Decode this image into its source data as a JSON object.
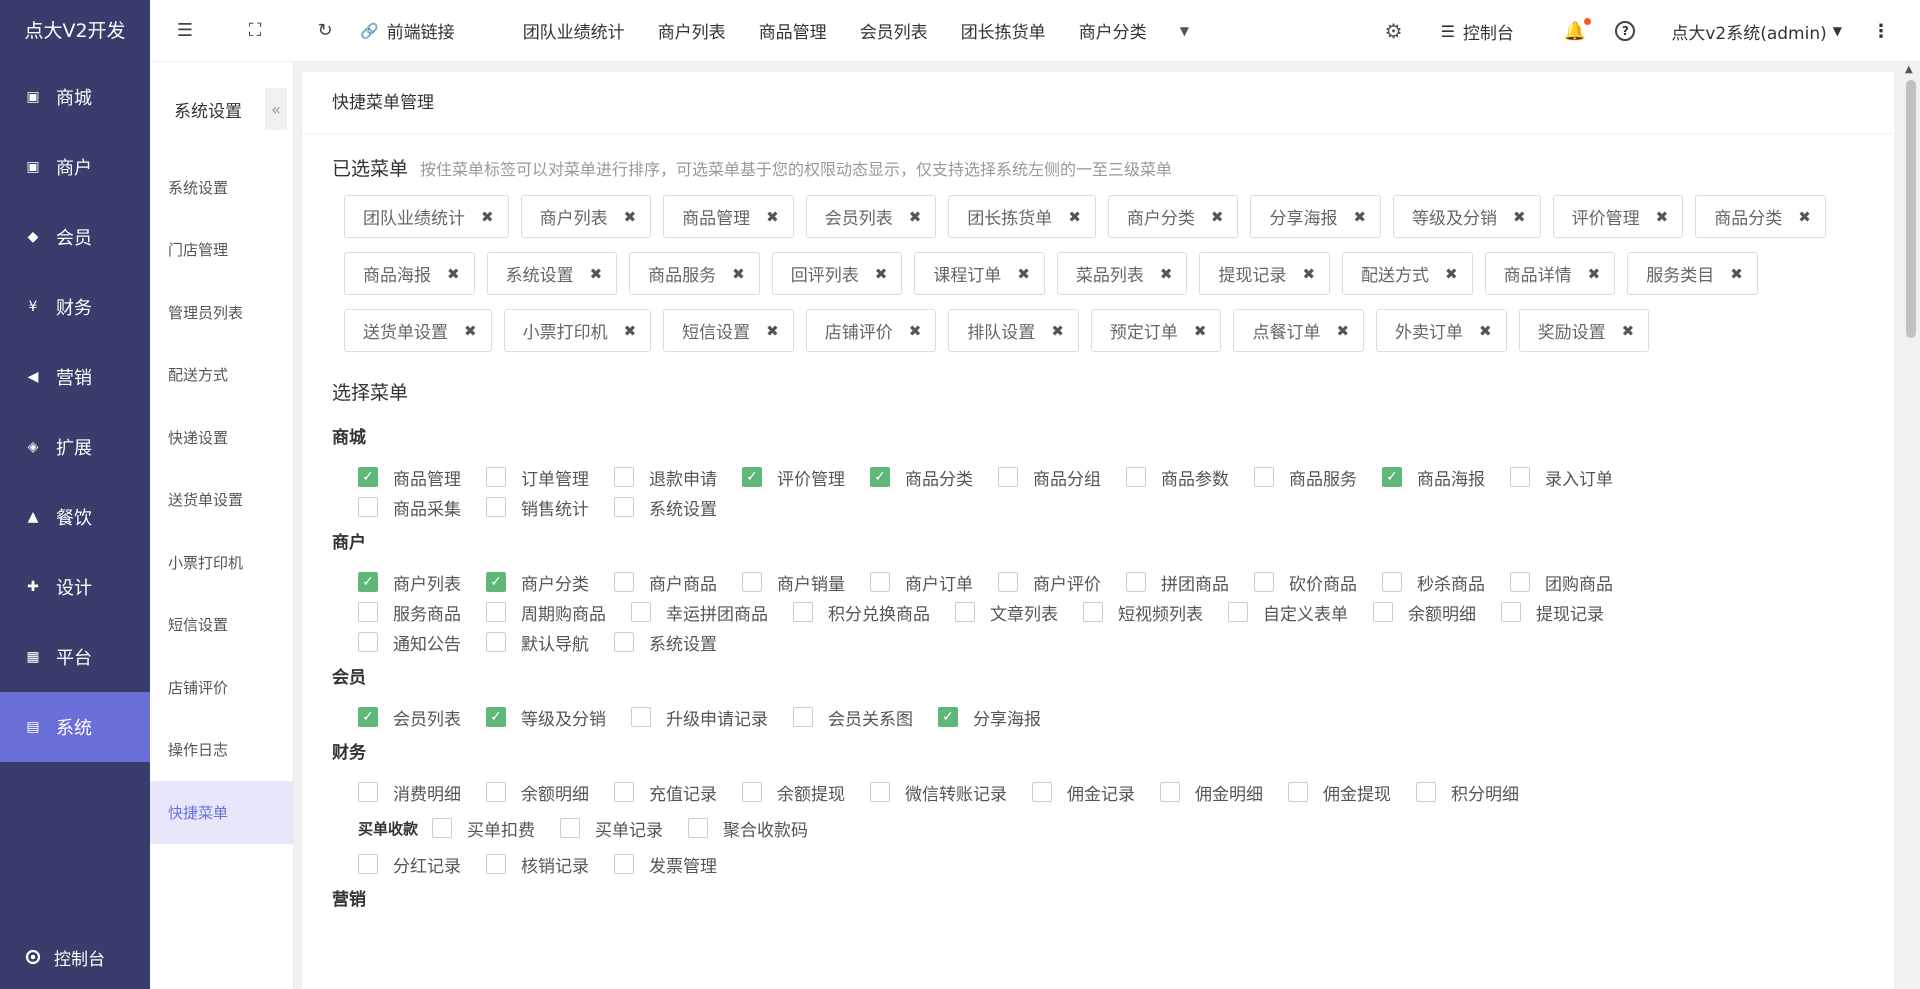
{
  "brand": "点大V2开发",
  "nav": [
    {
      "label": "商城",
      "icon": "shop-icon"
    },
    {
      "label": "商户",
      "icon": "merchant-icon"
    },
    {
      "label": "会员",
      "icon": "member-icon"
    },
    {
      "label": "财务",
      "icon": "finance-icon"
    },
    {
      "label": "营销",
      "icon": "marketing-icon"
    },
    {
      "label": "扩展",
      "icon": "extension-icon"
    },
    {
      "label": "餐饮",
      "icon": "dining-icon"
    },
    {
      "label": "设计",
      "icon": "design-icon"
    },
    {
      "label": "平台",
      "icon": "platform-icon"
    },
    {
      "label": "系统",
      "icon": "system-icon",
      "active": true
    }
  ],
  "nav_bottom": {
    "label": "控制台",
    "icon": "gear-icon"
  },
  "submenu": {
    "title": "系统设置",
    "items": [
      "系统设置",
      "门店管理",
      "管理员列表",
      "配送方式",
      "快递设置",
      "送货单设置",
      "小票打印机",
      "短信设置",
      "店铺评价",
      "操作日志",
      "快捷菜单"
    ],
    "active_index": 10
  },
  "topbar": {
    "frontend_link": "前端链接",
    "links": [
      "团队业绩统计",
      "商户列表",
      "商品管理",
      "会员列表",
      "团长拣货单",
      "商户分类"
    ],
    "console": "控制台",
    "user": "点大v2系统(admin)"
  },
  "card_title": "快捷菜单管理",
  "selected": {
    "title": "已选菜单",
    "hint": "按住菜单标签可以对菜单进行排序，可选菜单基于您的权限动态显示，仅支持选择系统左侧的一至三级菜单",
    "chips": [
      "团队业绩统计",
      "商户列表",
      "商品管理",
      "会员列表",
      "团长拣货单",
      "商户分类",
      "分享海报",
      "等级及分销",
      "评价管理",
      "商品分类",
      "商品海报",
      "系统设置",
      "商品服务",
      "回评列表",
      "课程订单",
      "菜品列表",
      "提现记录",
      "配送方式",
      "商品详情",
      "服务类目",
      "送货单设置",
      "小票打印机",
      "短信设置",
      "店铺评价",
      "排队设置",
      "预定订单",
      "点餐订单",
      "外卖订单",
      "奖励设置"
    ]
  },
  "choose_title": "选择菜单",
  "groups": [
    {
      "title": "商城",
      "options": [
        {
          "label": "商品管理",
          "checked": true
        },
        {
          "label": "订单管理",
          "checked": false
        },
        {
          "label": "退款申请",
          "checked": false
        },
        {
          "label": "评价管理",
          "checked": true
        },
        {
          "label": "商品分类",
          "checked": true
        },
        {
          "label": "商品分组",
          "checked": false
        },
        {
          "label": "商品参数",
          "checked": false
        },
        {
          "label": "商品服务",
          "checked": false
        },
        {
          "label": "商品海报",
          "checked": true
        },
        {
          "label": "录入订单",
          "checked": false
        },
        {
          "label": "商品采集",
          "checked": false
        },
        {
          "label": "销售统计",
          "checked": false
        },
        {
          "label": "系统设置",
          "checked": false
        }
      ]
    },
    {
      "title": "商户",
      "options": [
        {
          "label": "商户列表",
          "checked": true
        },
        {
          "label": "商户分类",
          "checked": true
        },
        {
          "label": "商户商品",
          "checked": false
        },
        {
          "label": "商户销量",
          "checked": false
        },
        {
          "label": "商户订单",
          "checked": false
        },
        {
          "label": "商户评价",
          "checked": false
        },
        {
          "label": "拼团商品",
          "checked": false
        },
        {
          "label": "砍价商品",
          "checked": false
        },
        {
          "label": "秒杀商品",
          "checked": false
        },
        {
          "label": "团购商品",
          "checked": false
        },
        {
          "label": "服务商品",
          "checked": false
        },
        {
          "label": "周期购商品",
          "checked": false
        },
        {
          "label": "幸运拼团商品",
          "checked": false
        },
        {
          "label": "积分兑换商品",
          "checked": false
        },
        {
          "label": "文章列表",
          "checked": false
        },
        {
          "label": "短视频列表",
          "checked": false
        },
        {
          "label": "自定义表单",
          "checked": false
        },
        {
          "label": "余额明细",
          "checked": false
        },
        {
          "label": "提现记录",
          "checked": false
        },
        {
          "label": "通知公告",
          "checked": false
        },
        {
          "label": "默认导航",
          "checked": false
        },
        {
          "label": "系统设置",
          "checked": false
        }
      ]
    },
    {
      "title": "会员",
      "options": [
        {
          "label": "会员列表",
          "checked": true
        },
        {
          "label": "等级及分销",
          "checked": true
        },
        {
          "label": "升级申请记录",
          "checked": false
        },
        {
          "label": "会员关系图",
          "checked": false
        },
        {
          "label": "分享海报",
          "checked": true
        }
      ]
    },
    {
      "title": "财务",
      "options": [
        {
          "label": "消费明细",
          "checked": false
        },
        {
          "label": "余额明细",
          "checked": false
        },
        {
          "label": "充值记录",
          "checked": false
        },
        {
          "label": "余额提现",
          "checked": false
        },
        {
          "label": "微信转账记录",
          "checked": false
        },
        {
          "label": "佣金记录",
          "checked": false
        },
        {
          "label": "佣金明细",
          "checked": false
        },
        {
          "label": "佣金提现",
          "checked": false
        },
        {
          "label": "积分明细",
          "checked": false
        }
      ],
      "subgroup": {
        "title": "买单收款",
        "options": [
          {
            "label": "买单扣费",
            "checked": false
          },
          {
            "label": "买单记录",
            "checked": false
          },
          {
            "label": "聚合收款码",
            "checked": false
          }
        ]
      },
      "extra_options": [
        {
          "label": "分红记录",
          "checked": false
        },
        {
          "label": "核销记录",
          "checked": false
        },
        {
          "label": "发票管理",
          "checked": false
        }
      ]
    },
    {
      "title": "营销",
      "options": []
    }
  ]
}
